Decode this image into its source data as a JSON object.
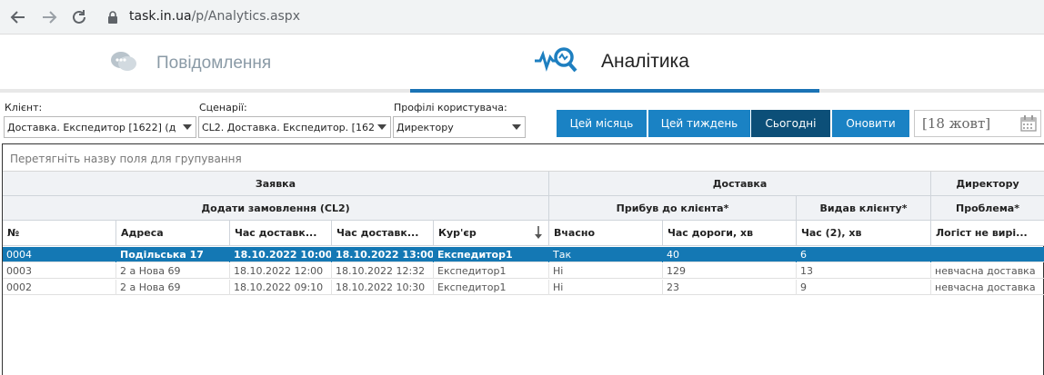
{
  "browser": {
    "url_host": "task.in.ua",
    "url_path": "/p/Analytics.aspx"
  },
  "tabs": [
    {
      "label": "Повідомлення",
      "icon": "chat-bubbles-icon",
      "active": false
    },
    {
      "label": "Аналітика",
      "icon": "analytics-magnifier-icon",
      "active": true
    }
  ],
  "filters": {
    "client": {
      "label": "Клієнт:",
      "value": "Доставка. Експедитор [1622] (д"
    },
    "scenario": {
      "label": "Сценарії:",
      "value": "CL2. Доставка. Експедитор. [162"
    },
    "profile": {
      "label": "Профілі користувача:",
      "value": "Директору"
    }
  },
  "buttons": {
    "month": "Цей місяць",
    "week": "Цей тиждень",
    "today": "Сьогодні",
    "refresh": "Оновити"
  },
  "date_value": "[18 жовт]",
  "grid": {
    "group_hint": "Перетягніть назву поля для групування",
    "bands": {
      "request": "Заявка",
      "delivery": "Доставка",
      "director": "Директору"
    },
    "subbands": {
      "add_order": "Додати замовлення (CL2)",
      "arrival": "Прибув до клієнта*",
      "handed": "Видав клієнту*",
      "problem": "Проблема*"
    },
    "columns": [
      "№",
      "Адреса",
      "Час доставк...",
      "Час доставк...",
      "Кур'єр",
      "Вчасно",
      "Час дороги, хв",
      "Час (2), хв",
      "Логіст не вирі..."
    ],
    "rows": [
      [
        "0004",
        "Подільська 17",
        "18.10.2022 10:00",
        "18.10.2022 13:00",
        "Експедитор1",
        "Так",
        "40",
        "6",
        ""
      ],
      [
        "0003",
        "2 а Нова 69",
        "18.10.2022 12:00",
        "18.10.2022 12:32",
        "Експедитор1",
        "Ні",
        "129",
        "13",
        "невчасна доставка"
      ],
      [
        "0002",
        "2 а Нова 69",
        "18.10.2022 09:10",
        "18.10.2022 10:30",
        "Експедитор1",
        "Ні",
        "23",
        "9",
        "невчасна доставка"
      ]
    ]
  },
  "colors": {
    "accent": "#1a82c4",
    "active_button": "#0c4f78",
    "selected_row": "#1478b4"
  }
}
